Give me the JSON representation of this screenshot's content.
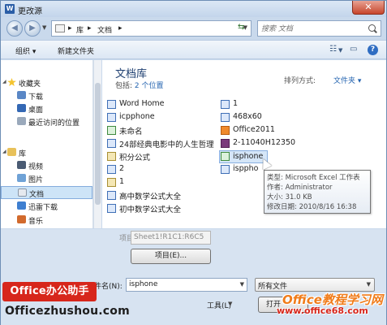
{
  "window": {
    "title": "更改源",
    "app_icon": "W",
    "close": "✕"
  },
  "address": {
    "segments": [
      "库",
      "文档"
    ],
    "separator": "▸",
    "search_placeholder": "搜索 文档"
  },
  "toolbar": {
    "organize": "组织 ▾",
    "new_folder": "新建文件夹"
  },
  "nav": {
    "favorites": "收藏夹",
    "favorites_items": [
      "下载",
      "桌面",
      "最近访问的位置"
    ],
    "libraries": "库",
    "library_items": [
      "视频",
      "图片",
      "文档",
      "迅雷下载",
      "音乐"
    ]
  },
  "library": {
    "title": "文档库",
    "subtitle_prefix": "包括: ",
    "subtitle_link": "2 个位置",
    "sort_label": "排列方式:",
    "sort_value": "文件夹 ▾"
  },
  "files_left": [
    {
      "name": "Word Home",
      "icon": "word"
    },
    {
      "name": "icpphone",
      "icon": "word"
    },
    {
      "name": "未命名",
      "icon": "excel"
    },
    {
      "name": "24部经典电影中的人生哲理",
      "icon": "word"
    },
    {
      "name": "积分公式",
      "icon": "zip"
    },
    {
      "name": "2",
      "icon": "word"
    },
    {
      "name": "1",
      "icon": "zip"
    },
    {
      "name": "高中数学公式大全",
      "icon": "word"
    },
    {
      "name": "初中数学公式大全",
      "icon": "word"
    }
  ],
  "files_right": [
    {
      "name": "1",
      "icon": "word"
    },
    {
      "name": "468x60",
      "icon": "word"
    },
    {
      "name": "Office2011",
      "icon": "app"
    },
    {
      "name": "2-11040H12350",
      "icon": "pdf"
    },
    {
      "name": "isphone",
      "icon": "excel"
    },
    {
      "name": "isppho",
      "icon": "word"
    }
  ],
  "tooltip": {
    "type": "类型: Microsoft Excel 工作表",
    "author": "作者: Administrator",
    "size": "大小: 31.0 KB",
    "modified": "修改日期: 2010/8/16 16:38"
  },
  "bottom": {
    "item_label": "项目(E):",
    "item_value": "Sheet1!R1C1:R6C5",
    "items_button": "项目(E)...",
    "filename_label": "文件名(N):",
    "filename_value": "isphone",
    "filetype_value": "所有文件",
    "tools_label": "工具(L)",
    "open_button": "打开"
  },
  "watermark": {
    "left_badge": "Office办公助手",
    "left_url": "Officezhushou.com",
    "right_title": "Office教程学习网",
    "right_url": "www.office68.com"
  },
  "colors": {
    "accent": "#2464b0",
    "selection": "#cde4f7",
    "watermark_red": "#d7261b",
    "watermark_orange": "#f07c1a"
  }
}
